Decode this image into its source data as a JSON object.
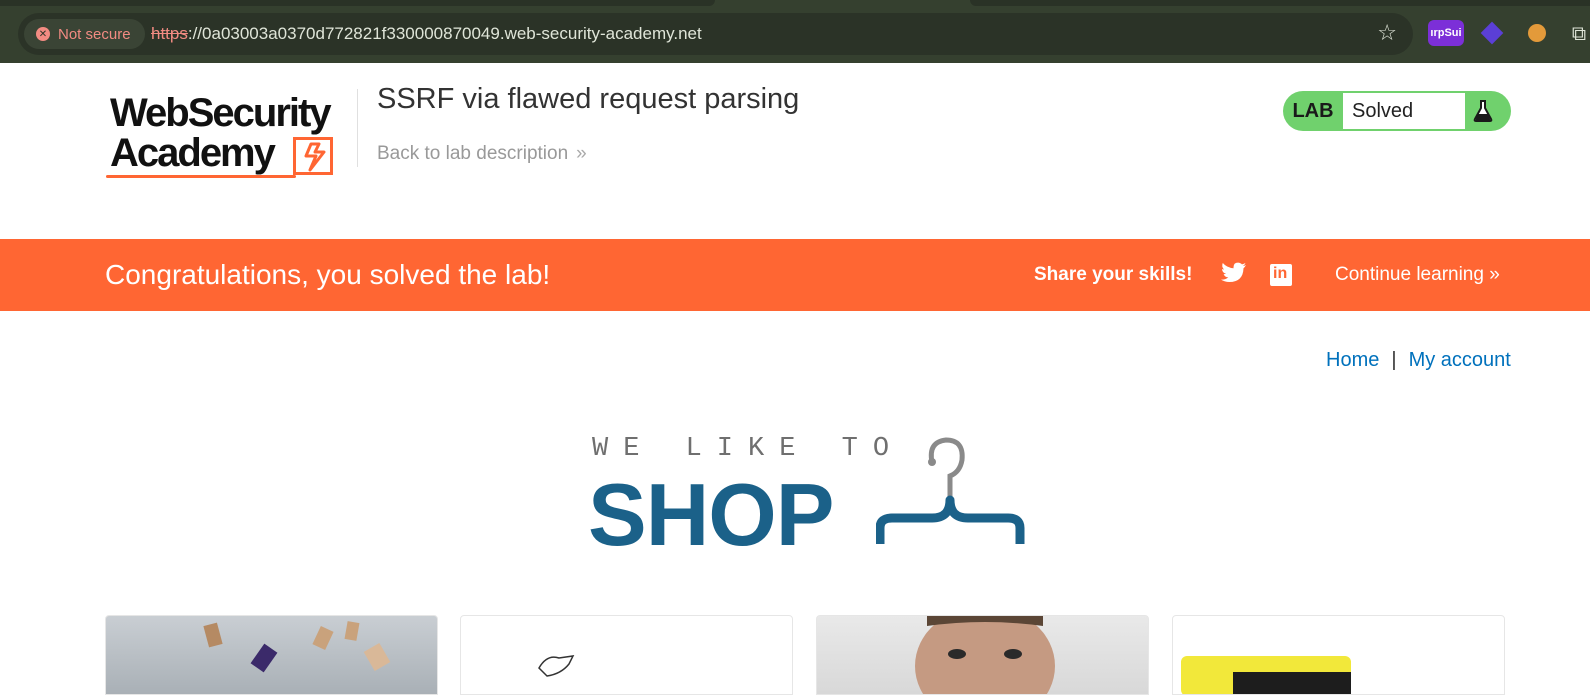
{
  "browser": {
    "security_label": "Not secure",
    "url_protocol": "https",
    "url_rest": "://0a03003a0370d772821f330000870049.web-security-academy.net",
    "extensions": [
      {
        "icon": "burp-suite-icon",
        "label": "ırpSui"
      },
      {
        "icon": "cube-icon"
      },
      {
        "icon": "cookie-icon"
      },
      {
        "icon": "puzzle-icon"
      }
    ]
  },
  "lab": {
    "logo_line1": "WebSecurity",
    "logo_line2": "Academy",
    "title": "SSRF via flawed request parsing",
    "back_link": "Back to lab description",
    "status_label": "LAB",
    "status_value": "Solved",
    "status_color": "#70d16d"
  },
  "banner": {
    "message": "Congratulations, you solved the lab!",
    "share": "Share your skills!",
    "continue": "Continue learning",
    "color": "#ff6633"
  },
  "nav": {
    "home": "Home",
    "separator": "|",
    "account": "My account"
  },
  "shop_logo": {
    "tagline": "WE LIKE TO",
    "word": "SHOP"
  }
}
